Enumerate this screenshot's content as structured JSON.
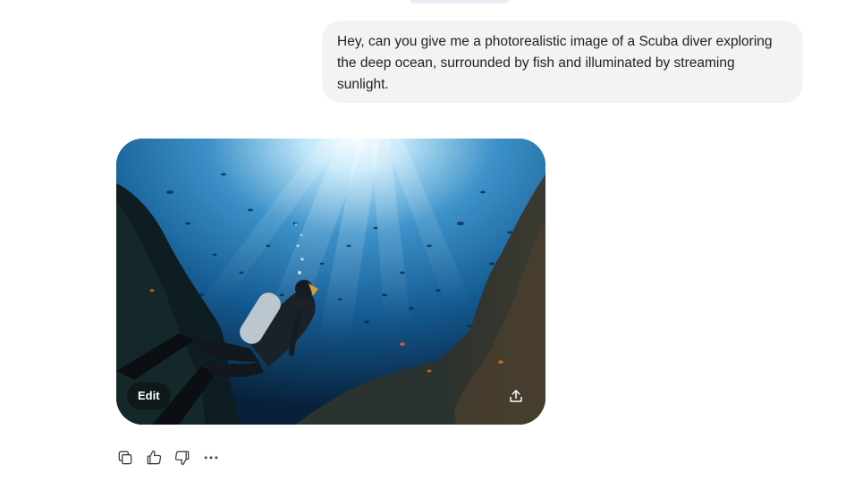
{
  "conversation": {
    "user_message": "Hey, can you give me a photorealistic image of a Scuba diver exploring the deep ocean, surrounded by fish and illuminated by streaming sunlight."
  },
  "generated_image": {
    "edit_label": "Edit",
    "share_icon": "share-upload-icon",
    "subject": "scuba diver underwater with fish and sun rays"
  },
  "message_actions": {
    "icons": [
      "copy-icon",
      "thumbs-up-icon",
      "thumbs-down-icon",
      "more-options-icon"
    ]
  },
  "colors": {
    "bubble_bg": "#f3f3f3",
    "ocean_deep": "#0b2a47",
    "ocean_mid": "#1c6fa8",
    "ocean_light": "#7fc3e6"
  }
}
